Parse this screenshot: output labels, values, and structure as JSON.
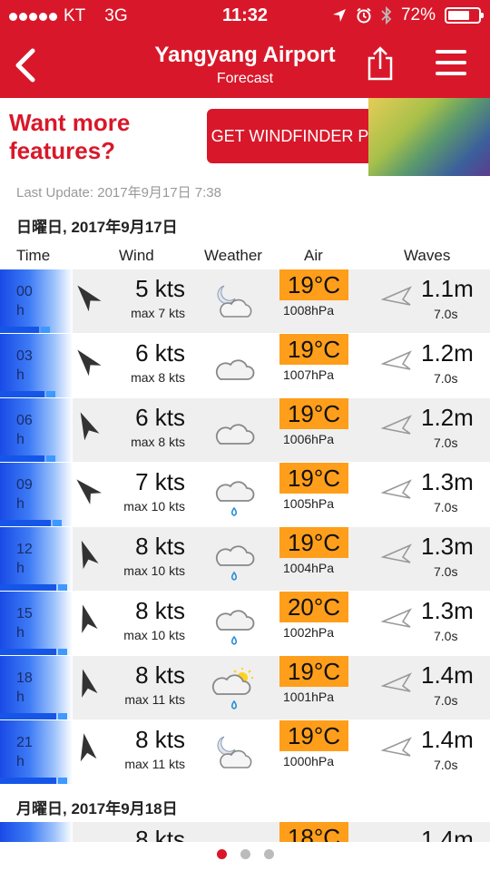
{
  "status": {
    "carrier": "KT",
    "network": "3G",
    "time": "11:32",
    "battery": "72%",
    "battery_level": 0.72
  },
  "nav": {
    "title": "Yangyang Airport",
    "subtitle": "Forecast",
    "icons": [
      "back-chevron-icon",
      "share-icon",
      "hamburger-menu-icon"
    ]
  },
  "banner": {
    "headline": "Want more features?",
    "button_label": "GET WINDFINDER PRO"
  },
  "last_update": "Last Update: 2017年9月17日 7:38",
  "day1": "日曜日, 2017年9月17日",
  "day2": "月曜日, 2017年9月18日",
  "columns": {
    "time": "Time",
    "wind": "Wind",
    "weather": "Weather",
    "air": "Air",
    "waves": "Waves"
  },
  "rows": [
    {
      "hour": "00",
      "unit": "h",
      "wind": "5 kts",
      "max": "max 7 kts",
      "weather": "night-partly-cloudy-icon",
      "temp": "19°C",
      "pressure": "1008hPa",
      "wave": "1.1m",
      "period": "7.0s",
      "wind_knots": 5
    },
    {
      "hour": "03",
      "unit": "h",
      "wind": "6 kts",
      "max": "max 8 kts",
      "weather": "cloudy-icon",
      "temp": "19°C",
      "pressure": "1007hPa",
      "wave": "1.2m",
      "period": "7.0s",
      "wind_knots": 6
    },
    {
      "hour": "06",
      "unit": "h",
      "wind": "6 kts",
      "max": "max 8 kts",
      "weather": "cloudy-icon",
      "temp": "19°C",
      "pressure": "1006hPa",
      "wave": "1.2m",
      "period": "7.0s",
      "wind_knots": 6
    },
    {
      "hour": "09",
      "unit": "h",
      "wind": "7 kts",
      "max": "max 10 kts",
      "weather": "cloudy-rain-icon",
      "temp": "19°C",
      "pressure": "1005hPa",
      "wave": "1.3m",
      "period": "7.0s",
      "wind_knots": 7
    },
    {
      "hour": "12",
      "unit": "h",
      "wind": "8 kts",
      "max": "max 10 kts",
      "weather": "cloudy-rain-icon",
      "temp": "19°C",
      "pressure": "1004hPa",
      "wave": "1.3m",
      "period": "7.0s",
      "wind_knots": 8
    },
    {
      "hour": "15",
      "unit": "h",
      "wind": "8 kts",
      "max": "max 10 kts",
      "weather": "cloudy-rain-icon",
      "temp": "20°C",
      "pressure": "1002hPa",
      "wave": "1.3m",
      "period": "7.0s",
      "wind_knots": 8
    },
    {
      "hour": "18",
      "unit": "h",
      "wind": "8 kts",
      "max": "max 11 kts",
      "weather": "sun-cloud-rain-icon",
      "temp": "19°C",
      "pressure": "1001hPa",
      "wave": "1.4m",
      "period": "7.0s",
      "wind_knots": 8
    },
    {
      "hour": "21",
      "unit": "h",
      "wind": "8 kts",
      "max": "max 11 kts",
      "weather": "night-partly-cloudy-icon",
      "temp": "19°C",
      "pressure": "1000hPa",
      "wave": "1.4m",
      "period": "7.0s",
      "wind_knots": 8
    }
  ],
  "partial_row": {
    "wind": "8 kts",
    "temp": "18°C",
    "wave": "1.4m"
  },
  "pager": {
    "pages": 3,
    "active": 0
  },
  "colors": {
    "brand_red": "#d8182a",
    "temp_orange": "#ff9e1a",
    "wind_blue": "#1556e8"
  }
}
